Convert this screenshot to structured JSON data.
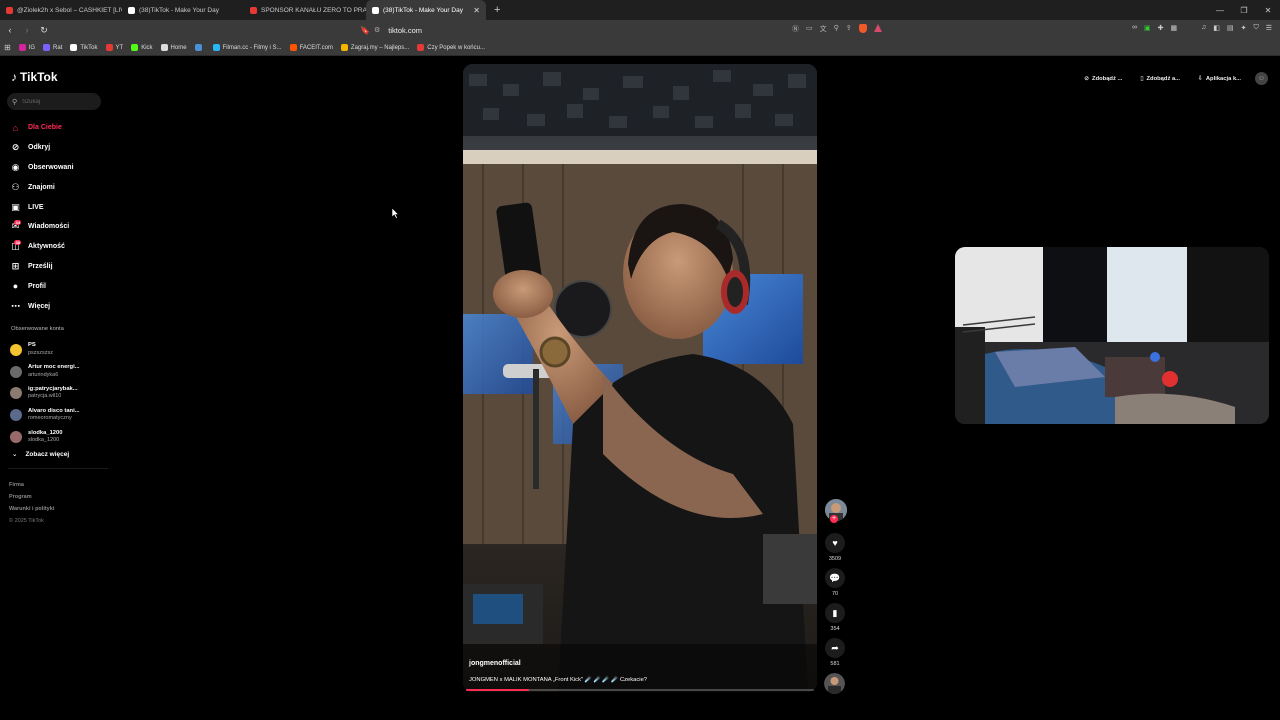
{
  "browser": {
    "tabs": [
      {
        "title": "@Ziolek2h x Sebol – CASHKIET [LIVE]",
        "color": "#e53935",
        "active": false
      },
      {
        "title": "(38)TikTok - Make Your Day",
        "color": "#ffffff",
        "active": false
      },
      {
        "title": "SPONSOR KANAŁU ZERO TO PRALNI",
        "color": "#e53935",
        "active": false
      },
      {
        "title": "(38)TikTok - Make Your Day",
        "color": "#ffffff",
        "active": true
      }
    ],
    "new_tab": "+",
    "url": "tiktok.com",
    "bookmarks": [
      {
        "label": "IG",
        "color": "#d6249f"
      },
      {
        "label": "Rat",
        "color": "#7b61ff"
      },
      {
        "label": "TikTok",
        "color": "#ffffff"
      },
      {
        "label": "YT",
        "color": "#e53935"
      },
      {
        "label": "Kick",
        "color": "#53fc18"
      },
      {
        "label": "Home",
        "color": "#dddddd"
      },
      {
        "label": "",
        "color": "#4a90d9"
      },
      {
        "label": "Filman.cc - Filmy i S...",
        "color": "#29b6f6"
      },
      {
        "label": "FACEIT.com",
        "color": "#ff5500"
      },
      {
        "label": "Zagraj.my – Najleps...",
        "color": "#f4b400"
      },
      {
        "label": "Czy Popek w końcu...",
        "color": "#e53935"
      }
    ]
  },
  "app": {
    "logo": "TikTok",
    "search_placeholder": "Szukaj",
    "nav": [
      {
        "label": "Dla Ciebie",
        "icon": "home-icon",
        "glyph": "⌂",
        "active": true,
        "badge": ""
      },
      {
        "label": "Odkryj",
        "icon": "compass-icon",
        "glyph": "⊘",
        "active": false,
        "badge": ""
      },
      {
        "label": "Obserwowani",
        "icon": "following-icon",
        "glyph": "◉",
        "active": false,
        "badge": ""
      },
      {
        "label": "Znajomi",
        "icon": "friends-icon",
        "glyph": "⚇",
        "active": false,
        "badge": ""
      },
      {
        "label": "LIVE",
        "icon": "live-icon",
        "glyph": "▣",
        "active": false,
        "badge": ""
      },
      {
        "label": "Wiadomości",
        "icon": "messages-icon",
        "glyph": "✉",
        "active": false,
        "badge": "34"
      },
      {
        "label": "Aktywność",
        "icon": "activity-icon",
        "glyph": "◫",
        "active": false,
        "badge": "38"
      },
      {
        "label": "Prześlij",
        "icon": "upload-icon",
        "glyph": "⊞",
        "active": false,
        "badge": ""
      },
      {
        "label": "Profil",
        "icon": "profile-icon",
        "glyph": "●",
        "active": false,
        "badge": ""
      },
      {
        "label": "Więcej",
        "icon": "more-icon",
        "glyph": "⋯",
        "active": false,
        "badge": ""
      }
    ],
    "following_title": "Obserwowane konta",
    "following": [
      {
        "name": "PS",
        "handle": "pszszszsz",
        "color": "#f4c430"
      },
      {
        "name": "Artur moc energi...",
        "handle": "arturindyka6",
        "color": "#6a6a6a"
      },
      {
        "name": "ig:patrycjarybak...",
        "handle": "patrycja.wil10",
        "color": "#8a7a70"
      },
      {
        "name": "Alvaro disco tani...",
        "handle": "romeoromatyczny",
        "color": "#5a6a8a"
      },
      {
        "name": "slodka_1200",
        "handle": "slodka_1200",
        "color": "#9a6a6a"
      }
    ],
    "see_more": "Zobacz więcej",
    "footer": [
      "Firma",
      "Program",
      "Warunki i polityki"
    ],
    "copyright": "© 2025 TikTok",
    "top_right": [
      "Zdobądź ...",
      "Zdobądź a...",
      "Aplikacja k..."
    ]
  },
  "video": {
    "username": "jongmenofficial",
    "caption": "JONGMEN x MALIK MONTANA „Front Kick\" ☄️ ☄️ ☄️ ☄️ Czekacie?",
    "progress": 0.18,
    "likes": "3509",
    "comments": "70",
    "saves": "354",
    "shares": "581"
  }
}
